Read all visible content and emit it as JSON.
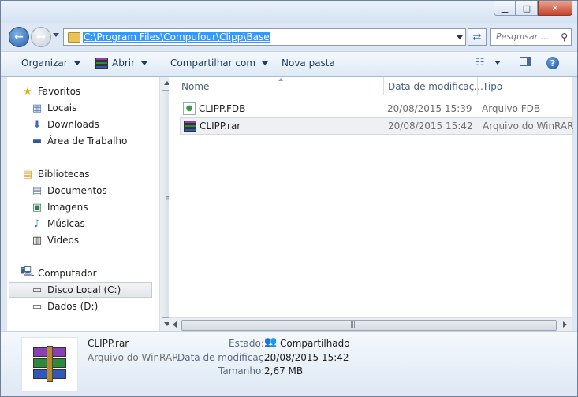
{
  "window": {
    "minimize": "▁",
    "maximize": "□",
    "close": "✕"
  },
  "address": {
    "path": "C:\\Program Files\\Compufour\\Clipp\\Base"
  },
  "search": {
    "placeholder": "Pesquisar ..."
  },
  "toolbar": {
    "organize": "Organizar",
    "open_with": "Abrir",
    "share": "Compartilhar com",
    "new_folder": "Nova pasta",
    "help": "?"
  },
  "sidebar": {
    "favorites": {
      "label": "Favoritos",
      "items": [
        "Locais",
        "Downloads",
        "Área de Trabalho"
      ]
    },
    "libraries": {
      "label": "Bibliotecas",
      "items": [
        "Documentos",
        "Imagens",
        "Músicas",
        "Vídeos"
      ]
    },
    "computer": {
      "label": "Computador",
      "items": [
        "Disco Local (C:)",
        "Dados (D:)"
      ]
    }
  },
  "columns": {
    "name": "Nome",
    "date": "Data de modificaç...",
    "type": "Tipo"
  },
  "files": [
    {
      "name": "CLIPP.FDB",
      "date": "20/08/2015 15:39",
      "type": "Arquivo FDB"
    },
    {
      "name": "CLIPP.rar",
      "date": "20/08/2015 15:42",
      "type": "Arquivo do WinRAR"
    }
  ],
  "details": {
    "name": "CLIPP.rar",
    "type": "Arquivo do WinRAR",
    "status_label": "Estado:",
    "status_value": "Compartilhado",
    "modified_label": "Data de modificaç...",
    "modified_value": "20/08/2015 15:42",
    "size_label": "Tamanho:",
    "size_value": "2,67 MB"
  },
  "colors": {
    "selection": "#3399ff",
    "toolbar_text": "#1e3b63",
    "frame": "#dde8f4"
  }
}
